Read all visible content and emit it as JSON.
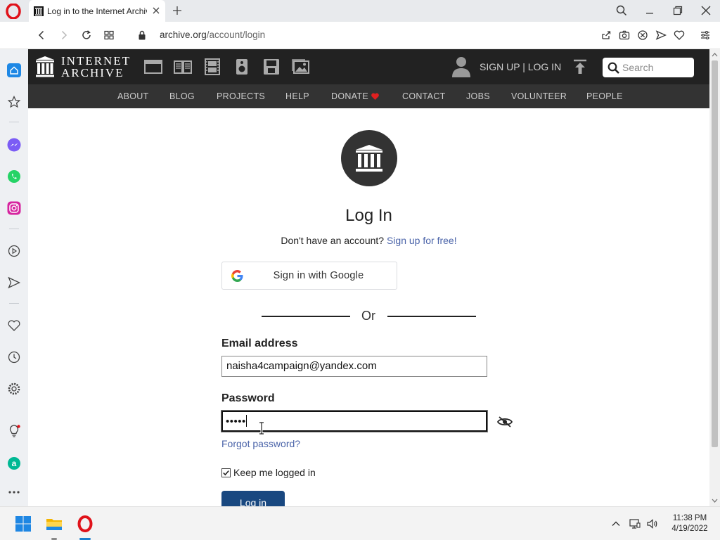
{
  "browser": {
    "tab_title": "Log in to the Internet Archive",
    "url_host": "archive.org",
    "url_path": "/account/login"
  },
  "site": {
    "logo_line1": "INTERNET",
    "logo_line2": "ARCHIVE",
    "signup_login": "SIGN UP | LOG IN",
    "search_placeholder": "Search",
    "nav": [
      "ABOUT",
      "BLOG",
      "PROJECTS",
      "HELP",
      "DONATE",
      "CONTACT",
      "JOBS",
      "VOLUNTEER",
      "PEOPLE"
    ],
    "colors": {
      "topbar": "#222222",
      "navbar": "#333333",
      "link": "#4b64a9",
      "button": "#194880",
      "heart": "#e02020"
    }
  },
  "login": {
    "title": "Log In",
    "no_account_text": "Don't have an account?",
    "signup_link": "Sign up for free",
    "signup_suffix": "!",
    "google_button": "Sign in with Google",
    "or_text": "Or",
    "email_label": "Email address",
    "email_value": "naisha4campaign@yandex.com",
    "password_label": "Password",
    "password_value": "•••••",
    "forgot_link": "Forgot password?",
    "keep_logged_in": "Keep me logged in",
    "keep_logged_in_checked": true,
    "login_button": "Log in"
  },
  "taskbar": {
    "time": "11:38 PM",
    "date": "4/19/2022"
  },
  "icons": {
    "sidebar": [
      "home-icon",
      "bookmarks-icon",
      "messenger-icon",
      "whatsapp-icon",
      "instagram-icon",
      "player-icon",
      "send-icon",
      "heart-icon",
      "history-icon",
      "settings-icon",
      "bulb-icon",
      "aria-icon",
      "more-icon"
    ],
    "media": [
      "web-icon",
      "texts-icon",
      "video-icon",
      "audio-icon",
      "software-icon",
      "images-icon"
    ]
  }
}
